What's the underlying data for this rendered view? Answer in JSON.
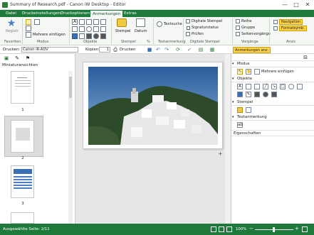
{
  "window": {
    "title": "Summary of Research.pdf - Canon iW Desktop - Editor",
    "minimize": "—",
    "maximize": "□",
    "close": "✕"
  },
  "tabs": [
    {
      "label": "Datei"
    },
    {
      "label": "Druckeinstellungen"
    },
    {
      "label": "Druckoptionen"
    },
    {
      "label": "Anmerkungen"
    },
    {
      "label": "Extras"
    }
  ],
  "ribbon": {
    "groups": {
      "favorites": "Favoriten",
      "mode": "Modus",
      "objects": "Objekte",
      "stamp": "Stempel",
      "text_annotation": "Textanmerkung",
      "digital_stamp": "Digitale Stempel",
      "operations": "Vorgänge",
      "view": "Ansic"
    },
    "register_label": "Registr.",
    "multi_insert": "Mehrere einfügen",
    "stempel": "Stempel",
    "datum": "Datum",
    "percent": "%",
    "textsuche": "Textsuche",
    "digitale_stempel": "Digitale Stempel",
    "signaturstatus": "Signaturstatus",
    "pruefen": "Prüfen",
    "reihe": "Reihe",
    "gruppe": "Gruppe",
    "seitenvorgaenge": "Seitenvorgänge",
    "navigation": "Navigation",
    "formatsymb": "Formatsymb."
  },
  "toolbar2": {
    "print_label": "Drucken:",
    "printer": "Canon iR-ADV",
    "copies_label": "Kopien:",
    "copies_value": "1",
    "print_button": "Drucken",
    "annotations_show": "Anmerkungen anz."
  },
  "leftpane": {
    "title": "Miniaturansichten",
    "pages": [
      "1",
      "2",
      "3"
    ]
  },
  "rightpane": {
    "modus": "Modus",
    "multi_insert": "Mehrere einfügen",
    "objekte": "Objekte",
    "stempel": "Stempel",
    "textanmerkung": "Textanmerkung",
    "eigenschaften": "Eigenschaften"
  },
  "statusbar": {
    "page_info": "Ausgewählte Seite: 2/11",
    "zoom": "100%",
    "minus": "−",
    "plus": "+"
  },
  "colors": {
    "accent_green": "#1e7a3a",
    "highlight_yellow": "#ffd24a"
  }
}
